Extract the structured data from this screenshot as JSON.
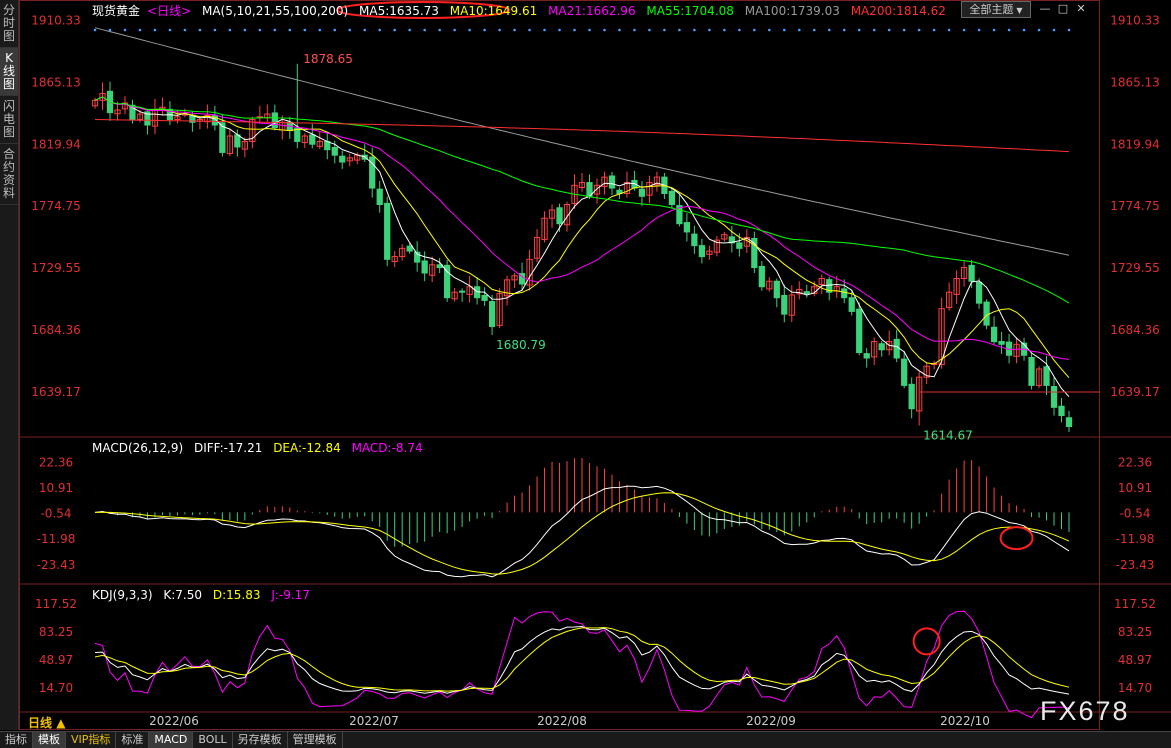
{
  "sidebar": {
    "tabs": [
      {
        "label": "分时图",
        "active": false
      },
      {
        "label": "K线图",
        "active": true
      },
      {
        "label": "闪电图",
        "active": false
      },
      {
        "label": "合约资料",
        "active": false
      }
    ]
  },
  "header": {
    "instrument": "现货黄金",
    "period_tag": "<日线>",
    "ma_params": "MA(5,10,21,55,100,200)",
    "ma_values": [
      {
        "label": "MA5:1635.73",
        "color": "#ffffff"
      },
      {
        "label": "MA10:1649.61",
        "color": "#ffff00"
      },
      {
        "label": "MA21:1662.96",
        "color": "#ff00ff"
      },
      {
        "label": "MA55:1704.08",
        "color": "#00ff00"
      },
      {
        "label": "MA100:1739.03",
        "color": "#9a9a9a"
      },
      {
        "label": "MA200:1814.62",
        "color": "#ff3030"
      }
    ],
    "theme_button": "全部主题"
  },
  "macd_header": {
    "params": "MACD(26,12,9)",
    "diff": "DIFF:-17.21",
    "dea": "DEA:-12.84",
    "macd": "MACD:-8.74"
  },
  "kdj_header": {
    "params": "KDJ(9,3,3)",
    "k": "K:7.50",
    "d": "D:15.83",
    "j": "J:-9.17"
  },
  "period_label": "日线",
  "bottom_tabs": [
    {
      "label": "指标",
      "active": false,
      "vip": false
    },
    {
      "label": "模板",
      "active": true,
      "vip": false
    },
    {
      "label": "VIP指标",
      "active": false,
      "vip": true
    },
    {
      "label": "标准",
      "active": false,
      "vip": false
    },
    {
      "label": "MACD",
      "active": true,
      "vip": false
    },
    {
      "label": "BOLL",
      "active": false,
      "vip": false
    },
    {
      "label": "另存模板",
      "active": false,
      "vip": false
    },
    {
      "label": "管理模板",
      "active": false,
      "vip": false
    }
  ],
  "watermark": "FX678",
  "chart_data": [
    {
      "type": "candlestick",
      "panel": "price",
      "y_ticks": [
        "1910.33",
        "1865.13",
        "1819.94",
        "1774.75",
        "1729.55",
        "1684.36",
        "1639.17"
      ],
      "ylim": [
        1610,
        1915
      ],
      "x_ticks": [
        "2022/06",
        "2022/07",
        "2022/08",
        "2022/09",
        "2022/10"
      ],
      "annotations": [
        {
          "text": "1878.65",
          "value": 1878.65
        },
        {
          "text": "1680.79",
          "value": 1680.79
        },
        {
          "text": "1614.67",
          "value": 1614.67
        }
      ],
      "support_line": 1639.17,
      "closes": [
        1852,
        1857,
        1843,
        1845,
        1850,
        1838,
        1842,
        1834,
        1845,
        1847,
        1838,
        1840,
        1842,
        1836,
        1838,
        1841,
        1834,
        1814,
        1826,
        1818,
        1822,
        1838,
        1840,
        1842,
        1832,
        1836,
        1830,
        1822,
        1826,
        1820,
        1822,
        1816,
        1812,
        1807,
        1810,
        1812,
        1809,
        1788,
        1776,
        1736,
        1738,
        1744,
        1742,
        1734,
        1726,
        1732,
        1730,
        1708,
        1712,
        1712,
        1716,
        1708,
        1706,
        1687,
        1711,
        1721,
        1724,
        1718,
        1736,
        1752,
        1766,
        1772,
        1762,
        1776,
        1790,
        1792,
        1782,
        1790,
        1796,
        1788,
        1784,
        1792,
        1788,
        1782,
        1792,
        1796,
        1784,
        1776,
        1762,
        1756,
        1746,
        1738,
        1742,
        1750,
        1754,
        1748,
        1744,
        1752,
        1730,
        1716,
        1720,
        1708,
        1696,
        1710,
        1714,
        1711,
        1716,
        1722,
        1712,
        1716,
        1708,
        1698,
        1668,
        1664,
        1676,
        1670,
        1676,
        1664,
        1644,
        1627,
        1650,
        1658,
        1660,
        1700,
        1712,
        1722,
        1730,
        1720,
        1704,
        1688,
        1676,
        1674,
        1666,
        1674,
        1666,
        1644,
        1656,
        1644,
        1628,
        1622,
        1614
      ],
      "series": [
        {
          "name": "MA5",
          "color": "#ffffff",
          "last": 1635.73
        },
        {
          "name": "MA10",
          "color": "#ffff00",
          "last": 1649.61
        },
        {
          "name": "MA21",
          "color": "#ff00ff",
          "last": 1662.96
        },
        {
          "name": "MA55",
          "color": "#00ff00",
          "last": 1704.08
        },
        {
          "name": "MA100",
          "color": "#9a9a9a",
          "last": 1739.03
        },
        {
          "name": "MA200",
          "color": "#ff3030",
          "last": 1814.62
        }
      ]
    },
    {
      "type": "bar",
      "panel": "macd",
      "y_ticks": [
        "22.36",
        "10.91",
        "-0.54",
        "-11.98",
        "-23.43"
      ],
      "ylim": [
        -28,
        27
      ],
      "series": [
        {
          "name": "DIFF",
          "color": "#ffffff",
          "last": -17.21
        },
        {
          "name": "DEA",
          "color": "#ffff00",
          "last": -12.84
        },
        {
          "name": "MACD",
          "color": "#ff00ff",
          "last": -8.74
        }
      ]
    },
    {
      "type": "line",
      "panel": "kdj",
      "y_ticks": [
        "117.52",
        "83.25",
        "48.97",
        "14.70"
      ],
      "ylim": [
        -12,
        125
      ],
      "series": [
        {
          "name": "K",
          "color": "#ffffff",
          "last": 7.5
        },
        {
          "name": "D",
          "color": "#ffff00",
          "last": 15.83
        },
        {
          "name": "J",
          "color": "#ff00ff",
          "last": -9.17
        }
      ]
    }
  ]
}
